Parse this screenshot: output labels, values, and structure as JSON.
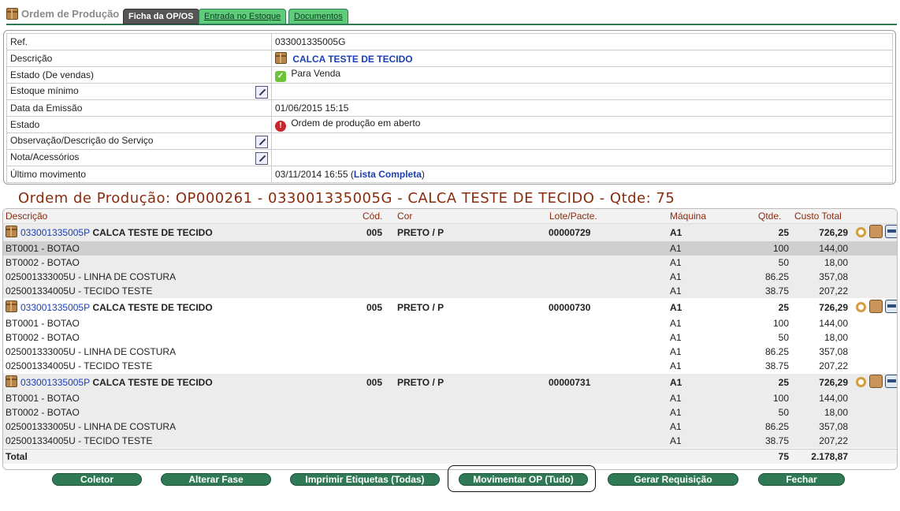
{
  "tabs": {
    "title": "Ordem de Produção",
    "items": [
      {
        "label": "Ficha da OP/OS"
      },
      {
        "label": "Entrada no Estoque"
      },
      {
        "label": "Documentos"
      }
    ]
  },
  "info": {
    "ref_label": "Ref.",
    "ref_value": "033001335005G",
    "desc_label": "Descrição",
    "desc_value": "CALCA TESTE DE TECIDO",
    "estado_vendas_label": "Estado (De vendas)",
    "estado_vendas_value": "Para Venda",
    "estoque_label": "Estoque mínimo",
    "estoque_value": "",
    "emissao_label": "Data da Emissão",
    "emissao_value": "01/06/2015 15:15",
    "estado_label": "Estado",
    "estado_value": "Ordem de produção em aberto",
    "obs_label": "Observação/Descrição do Serviço",
    "obs_value": "",
    "nota_label": "Nota/Acessórios",
    "nota_value": "",
    "ultimo_label": "Último movimento",
    "ultimo_value": "03/11/2014 16:55 (",
    "ultimo_link": "Lista Completa",
    "ultimo_close": ")"
  },
  "op_title": "Ordem de Produção: OP000261 - 033001335005G - CALCA TESTE DE TECIDO - Qtde: 75",
  "grid": {
    "headers": {
      "descricao": "Descrição",
      "cod": "Cód.",
      "cor": "Cor",
      "lote": "Lote/Pacte.",
      "maquina": "Máquina",
      "qtde": "Qtde.",
      "custo": "Custo Total"
    },
    "groups": [
      {
        "code": "033001335005P",
        "name": "CALCA TESTE DE TECIDO",
        "cod": "005",
        "cor": "PRETO / P",
        "lote": "00000729",
        "maquina": "A1",
        "qtde": "25",
        "custo": "726,29",
        "items": [
          {
            "desc": "BT0001 - BOTAO",
            "maquina": "A1",
            "qtde": "100",
            "custo": "144,00"
          },
          {
            "desc": "BT0002 - BOTAO",
            "maquina": "A1",
            "qtde": "50",
            "custo": "18,00"
          },
          {
            "desc": "025001333005U - LINHA DE COSTURA",
            "maquina": "A1",
            "qtde": "86.25",
            "custo": "357,08"
          },
          {
            "desc": "025001334005U - TECIDO TESTE",
            "maquina": "A1",
            "qtde": "38.75",
            "custo": "207,22"
          }
        ]
      },
      {
        "code": "033001335005P",
        "name": "CALCA TESTE DE TECIDO",
        "cod": "005",
        "cor": "PRETO / P",
        "lote": "00000730",
        "maquina": "A1",
        "qtde": "25",
        "custo": "726,29",
        "items": [
          {
            "desc": "BT0001 - BOTAO",
            "maquina": "A1",
            "qtde": "100",
            "custo": "144,00"
          },
          {
            "desc": "BT0002 - BOTAO",
            "maquina": "A1",
            "qtde": "50",
            "custo": "18,00"
          },
          {
            "desc": "025001333005U - LINHA DE COSTURA",
            "maquina": "A1",
            "qtde": "86.25",
            "custo": "357,08"
          },
          {
            "desc": "025001334005U - TECIDO TESTE",
            "maquina": "A1",
            "qtde": "38.75",
            "custo": "207,22"
          }
        ]
      },
      {
        "code": "033001335005P",
        "name": "CALCA TESTE DE TECIDO",
        "cod": "005",
        "cor": "PRETO / P",
        "lote": "00000731",
        "maquina": "A1",
        "qtde": "25",
        "custo": "726,29",
        "items": [
          {
            "desc": "BT0001 - BOTAO",
            "maquina": "A1",
            "qtde": "100",
            "custo": "144,00"
          },
          {
            "desc": "BT0002 - BOTAO",
            "maquina": "A1",
            "qtde": "50",
            "custo": "18,00"
          },
          {
            "desc": "025001333005U - LINHA DE COSTURA",
            "maquina": "A1",
            "qtde": "86.25",
            "custo": "357,08"
          },
          {
            "desc": "025001334005U - TECIDO TESTE",
            "maquina": "A1",
            "qtde": "38.75",
            "custo": "207,22"
          }
        ]
      }
    ],
    "total": {
      "label": "Total",
      "qtde": "75",
      "custo": "2.178,87"
    }
  },
  "buttons": {
    "coletor": "Coletor",
    "alterar_fase": "Alterar Fase",
    "imprimir": "Imprimir Etiquetas (Todas)",
    "movimentar": "Movimentar OP (Tudo)",
    "gerar": "Gerar Requisição",
    "fechar": "Fechar"
  },
  "colors": {
    "accent": "#2f7a55",
    "title": "#8a2b0e",
    "link": "#1a3fb4"
  }
}
